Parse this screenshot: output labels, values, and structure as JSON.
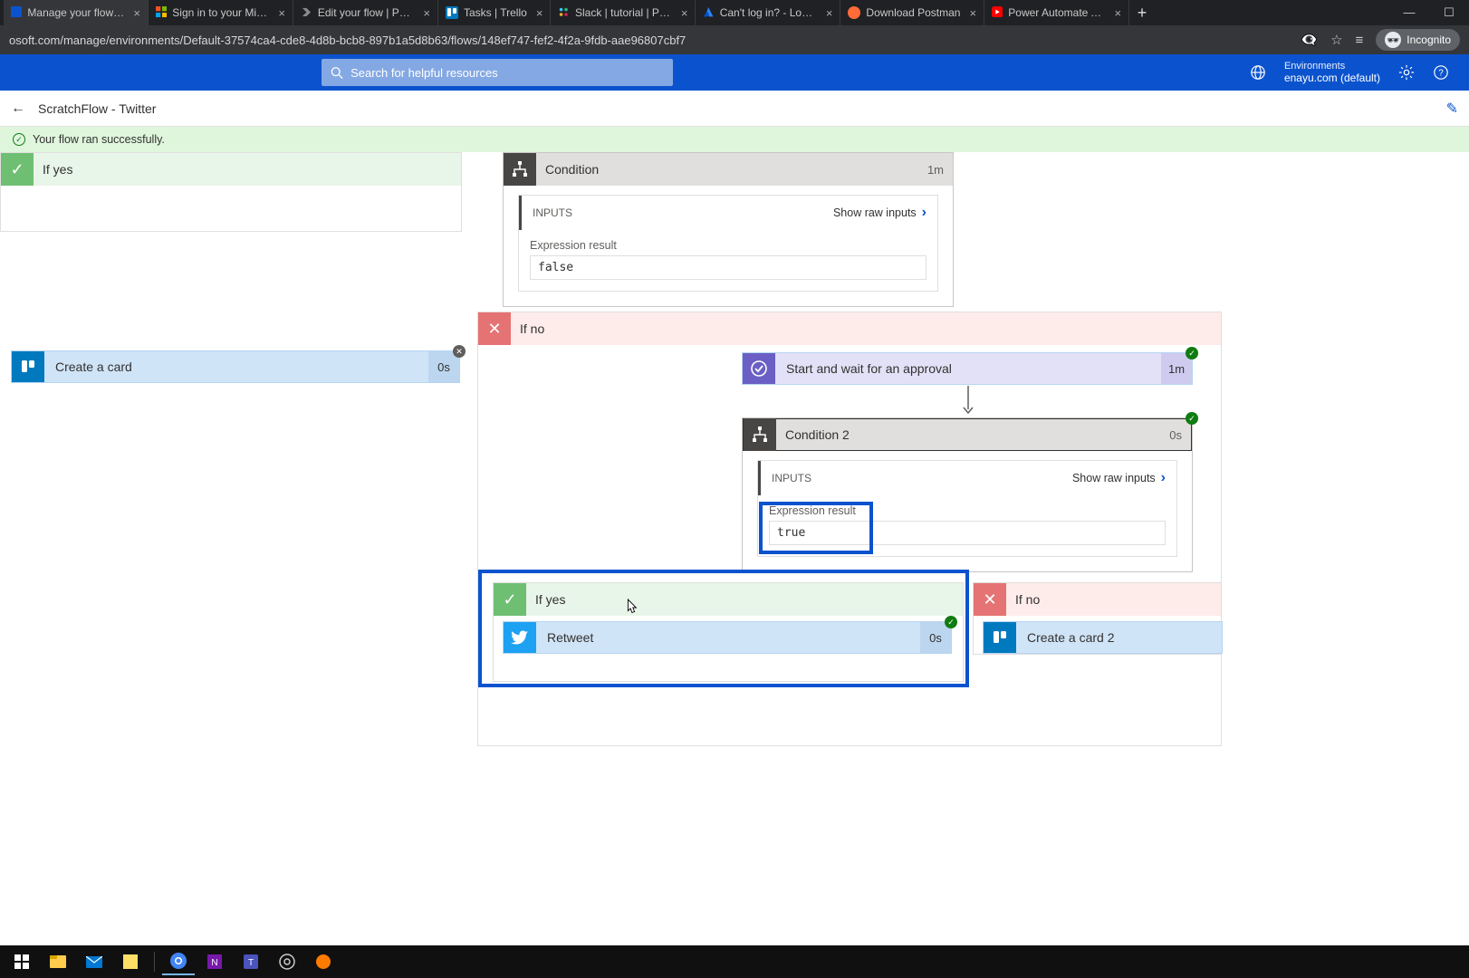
{
  "browser": {
    "tabs": [
      {
        "label": "Manage your flows | M"
      },
      {
        "label": "Sign in to your Microso"
      },
      {
        "label": "Edit your flow | Power"
      },
      {
        "label": "Tasks | Trello"
      },
      {
        "label": "Slack | tutorial | Power"
      },
      {
        "label": "Can't log in? - Log in w"
      },
      {
        "label": "Download Postman"
      },
      {
        "label": "Power Automate Appro"
      }
    ],
    "url": "osoft.com/manage/environments/Default-37574ca4-cde8-4d8b-bcb8-897b1a5d8b63/flows/148ef747-fef2-4f2a-9fdb-aae96807cbf7",
    "incognito_label": "Incognito"
  },
  "pa": {
    "search_placeholder": "Search for helpful resources",
    "env_label": "Environments",
    "env_name": "enayu.com (default)"
  },
  "crumb": {
    "title": "ScratchFlow - Twitter"
  },
  "banner": {
    "msg": "Your flow ran successfully."
  },
  "cond1": {
    "title": "Condition",
    "duration": "1m",
    "inputs_label": "INPUTS",
    "raw_label": "Show raw inputs",
    "expr_label": "Expression result",
    "expr_value": "false"
  },
  "ifyes1": {
    "title": "If yes"
  },
  "ifno1": {
    "title": "If no"
  },
  "create_card": {
    "title": "Create a card",
    "duration": "0s"
  },
  "approval": {
    "title": "Start and wait for an approval",
    "duration": "1m"
  },
  "cond2": {
    "title": "Condition 2",
    "duration": "0s",
    "inputs_label": "INPUTS",
    "raw_label": "Show raw inputs",
    "expr_label": "Expression result",
    "expr_value": "true"
  },
  "ifyes2": {
    "title": "If yes"
  },
  "ifno2": {
    "title": "If no"
  },
  "retweet": {
    "title": "Retweet",
    "duration": "0s"
  },
  "create_card2": {
    "title": "Create a card 2"
  }
}
